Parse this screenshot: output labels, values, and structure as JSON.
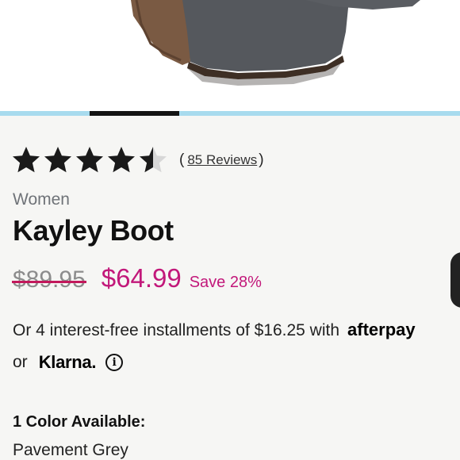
{
  "product": {
    "image_alt": "Kayley Boot in Pavement Grey suede",
    "rating": 4.5,
    "rating_max": 5,
    "reviews_text": "85 Reviews",
    "reviews_open": "(",
    "reviews_close": ")",
    "category": "Women",
    "title": "Kayley Boot"
  },
  "carousel": {
    "active_index": 1,
    "count": 5
  },
  "pricing": {
    "original": "$89.95",
    "sale": "$64.99",
    "save": "Save 28%",
    "installments_text": "Or 4 interest-free installments of $16.25 with",
    "afterpay_brand": "afterpay",
    "or_text": "or",
    "klarna_brand": "Klarna.",
    "info_symbol": "i"
  },
  "colors": {
    "label": "1 Color Available:",
    "selected": "Pavement Grey"
  },
  "theme": {
    "accent": "#c2187a",
    "star_filled": "#1a1a1a",
    "star_empty": "#d7d7d7",
    "carousel_track": "#a8dbee"
  }
}
